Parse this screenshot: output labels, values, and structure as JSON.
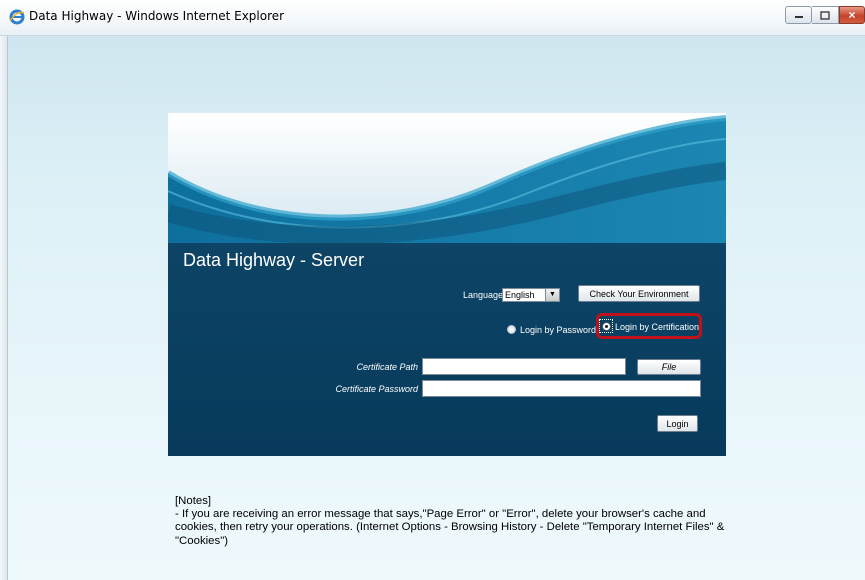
{
  "window": {
    "title": "Data Highway - Windows Internet Explorer",
    "close_glyph": "×"
  },
  "panel": {
    "title": "Data Highway - Server",
    "language_label": "Language",
    "language_value": "English",
    "check_button": "Check Your Environment",
    "login_by_password": "Login by Password",
    "login_by_certification": "Login by Certification",
    "selected_login_mode": "certification",
    "certificate_path_label": "Certificate Path",
    "certificate_path_value": "",
    "file_button": "File",
    "certificate_password_label": "Certificate Password",
    "certificate_password_value": "",
    "login_button": "Login"
  },
  "notes": {
    "heading": "[Notes]",
    "text": "- If you are receiving an error message that says,\"Page Error\" or \"Error\", delete your browser's cache and cookies, then retry your operations. (Internet Options - Browsing History - Delete \"Temporary Internet Files\" & \"Cookies\")"
  },
  "colors": {
    "panel_dark": "#073a5b",
    "highlight": "#c0101a",
    "client_bg": "#def1f7"
  },
  "icons": [
    "ie-logo-icon",
    "minimize-icon",
    "maximize-icon",
    "close-icon",
    "dropdown-arrow-icon"
  ]
}
